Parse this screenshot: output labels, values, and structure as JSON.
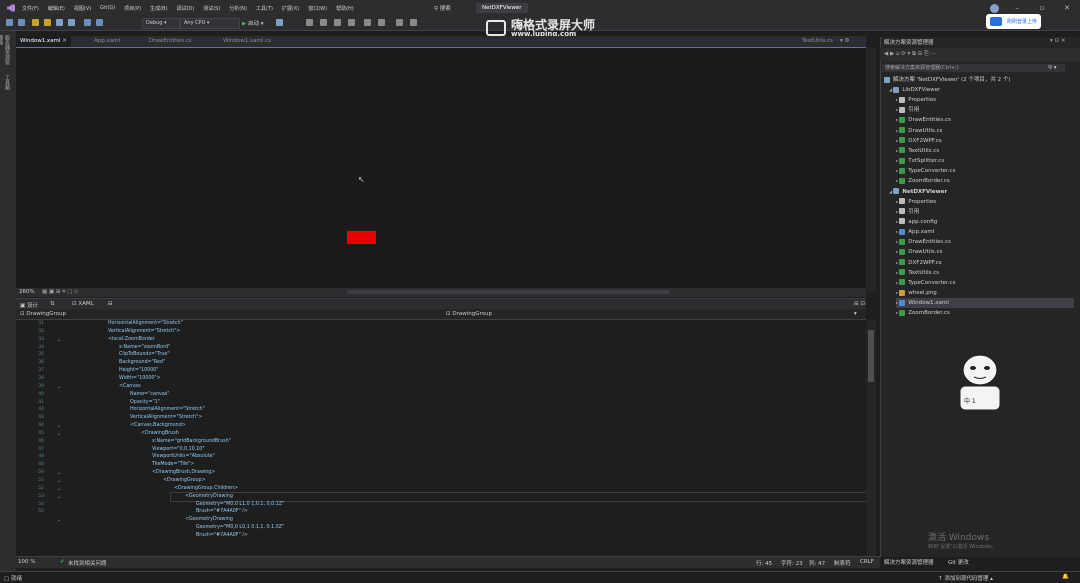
{
  "menubar": {
    "items": [
      "文件(F)",
      "编辑(E)",
      "视图(V)",
      "Git(G)",
      "项目(P)",
      "生成(B)",
      "调试(D)",
      "测试(S)",
      "分析(N)",
      "工具(T)",
      "扩展(X)",
      "窗口(W)",
      "帮助(H)"
    ],
    "search_label": "搜索",
    "solution_name": "NetDXFViewer"
  },
  "toolbar": {
    "config": "Debug",
    "platform": "Any CPU",
    "start_label": "启动"
  },
  "watermark": {
    "title": "嗨格式录屏大师",
    "url": "www.luping.com"
  },
  "upload": {
    "label": "刚刚登录上传"
  },
  "leftstrip": {
    "labels": [
      "服务器资源管理器",
      "工具箱"
    ]
  },
  "doctabs": [
    {
      "label": "Window1.xaml",
      "active": true
    },
    {
      "label": "App.xaml",
      "active": false
    },
    {
      "label": "DrawEntities.cs",
      "active": false
    },
    {
      "label": "Window1.xaml.cs",
      "active": false
    }
  ],
  "doctab_right": "TextUtils.cs",
  "zoombar": {
    "zoom": "260%"
  },
  "splitbar": {
    "design_label": "设计",
    "xaml_label": "XAML"
  },
  "navbar": {
    "left": "DrawingGroup",
    "right": "DrawingGroup"
  },
  "editor": {
    "line_numbers": [
      "31",
      "32",
      "33",
      "34",
      "35",
      "36",
      "37",
      "38",
      "39",
      "40",
      "41",
      "42",
      "43",
      "44",
      "45",
      "46",
      "47",
      "48",
      "49",
      "50",
      "51",
      "52",
      "53",
      "54",
      "55"
    ],
    "lines": [
      {
        "indent": 0,
        "text": "HorizontalAlignment=\"Stretch\""
      },
      {
        "indent": 0,
        "text": "VerticalAlignment=\"Stretch\">"
      },
      {
        "indent": 0,
        "text": "<local:ZoomBorder"
      },
      {
        "indent": 1,
        "text": "x:Name=\"zoomBord\""
      },
      {
        "indent": 1,
        "text": "ClipToBounds=\"True\""
      },
      {
        "indent": 1,
        "text": "Background=\"Red\""
      },
      {
        "indent": 1,
        "text": "Height=\"10000\""
      },
      {
        "indent": 1,
        "text": "Width=\"10000\">"
      },
      {
        "indent": 1,
        "text": "<Canvas"
      },
      {
        "indent": 2,
        "text": "Name=\"canvas\""
      },
      {
        "indent": 2,
        "text": "Opacity=\"1\""
      },
      {
        "indent": 2,
        "text": "HorizontalAlignment=\"Stretch\""
      },
      {
        "indent": 2,
        "text": "VerticalAlignment=\"Stretch\">"
      },
      {
        "indent": 2,
        "text": "<Canvas.Background>"
      },
      {
        "indent": 3,
        "text": "<DrawingBrush"
      },
      {
        "indent": 4,
        "text": "x:Name=\"gridBackgroundBrush\""
      },
      {
        "indent": 4,
        "text": "Viewport=\"0,0,10,10\""
      },
      {
        "indent": 4,
        "text": "ViewportUnits=\"Absolute\""
      },
      {
        "indent": 4,
        "text": "TileMode=\"Tile\">"
      },
      {
        "indent": 4,
        "text": "<DrawingBrush.Drawing>"
      },
      {
        "indent": 5,
        "text": "<DrawingGroup>"
      },
      {
        "indent": 6,
        "text": "<DrawingGroup.Children>"
      },
      {
        "indent": 7,
        "text": "<GeometryDrawing"
      },
      {
        "indent": 8,
        "text": "Geometry=\"M0,0 L1,0 1,0.1, 0,0.1Z\""
      },
      {
        "indent": 8,
        "text": "Brush=\"#7A4A0F\" />"
      },
      {
        "indent": 7,
        "text": "<GeometryDrawing"
      },
      {
        "indent": 8,
        "text": "Geometry=\"M0,0 L0,1 0.1,1, 0.1,0Z\""
      },
      {
        "indent": 8,
        "text": "Brush=\"#7A4A0F\" />"
      }
    ]
  },
  "edstatus": {
    "zoom": "100 %",
    "issues": "未找到相关问题",
    "line": "行: 45",
    "char": "字符: 23",
    "col": "列: 47",
    "tab": "制表符",
    "crlf": "CRLF"
  },
  "solution": {
    "title": "解决方案资源管理器",
    "search_placeholder": "搜索解决方案资源管理器(Ctrl+;)",
    "root": "解决方案 'NetDXFViewer' (2 个项目，共 2 个)",
    "items": [
      {
        "label": "LibDXFViewer",
        "level": 1,
        "kind": "project",
        "bold": false
      },
      {
        "label": "Properties",
        "level": 2,
        "kind": "wrench",
        "bold": false
      },
      {
        "label": "引用",
        "level": 2,
        "kind": "ref",
        "bold": false
      },
      {
        "label": "DrawEntities.cs",
        "level": 2,
        "kind": "cs",
        "bold": false
      },
      {
        "label": "DrawUtils.cs",
        "level": 2,
        "kind": "cs",
        "bold": false
      },
      {
        "label": "DXF2WPF.cs",
        "level": 2,
        "kind": "cs",
        "bold": false
      },
      {
        "label": "TextUtils.cs",
        "level": 2,
        "kind": "cs",
        "bold": false
      },
      {
        "label": "TxtSplitter.cs",
        "level": 2,
        "kind": "cs",
        "bold": false
      },
      {
        "label": "TypeConverter.cs",
        "level": 2,
        "kind": "cs",
        "bold": false
      },
      {
        "label": "ZoomBorder.cs",
        "level": 2,
        "kind": "cs",
        "bold": false
      },
      {
        "label": "NetDXFViewer",
        "level": 1,
        "kind": "project",
        "bold": true
      },
      {
        "label": "Properties",
        "level": 2,
        "kind": "wrench",
        "bold": false
      },
      {
        "label": "引用",
        "level": 2,
        "kind": "ref",
        "bold": false
      },
      {
        "label": "app.config",
        "level": 2,
        "kind": "file",
        "bold": false
      },
      {
        "label": "App.xaml",
        "level": 2,
        "kind": "xaml",
        "bold": false
      },
      {
        "label": "DrawEntities.cs",
        "level": 2,
        "kind": "cs",
        "bold": false
      },
      {
        "label": "DrawUtils.cs",
        "level": 2,
        "kind": "cs",
        "bold": false
      },
      {
        "label": "DXF2WPF.cs",
        "level": 2,
        "kind": "cs",
        "bold": false
      },
      {
        "label": "TextUtils.cs",
        "level": 2,
        "kind": "cs",
        "bold": false
      },
      {
        "label": "TypeConverter.cs",
        "level": 2,
        "kind": "cs",
        "bold": false
      },
      {
        "label": "wheel.png",
        "level": 2,
        "kind": "image",
        "bold": false
      },
      {
        "label": "Window1.xaml",
        "level": 2,
        "kind": "xaml",
        "bold": false,
        "selected": true
      },
      {
        "label": "ZoomBorder.cs",
        "level": 2,
        "kind": "cs",
        "bold": false
      }
    ],
    "bottom_tabs": [
      "解决方案资源管理器",
      "Git 更改"
    ]
  },
  "mascot_badge": "中 1",
  "windows_mark": {
    "line1": "激活 Windows",
    "line2": "转到\"设置\"以激活 Windows。"
  },
  "statusbar": {
    "left": "就绪",
    "right": "添加到源代码管理"
  },
  "colors": {
    "accent": "#5a6cd6",
    "red_element": "#ea0000",
    "bg": "#1e1e1e"
  }
}
